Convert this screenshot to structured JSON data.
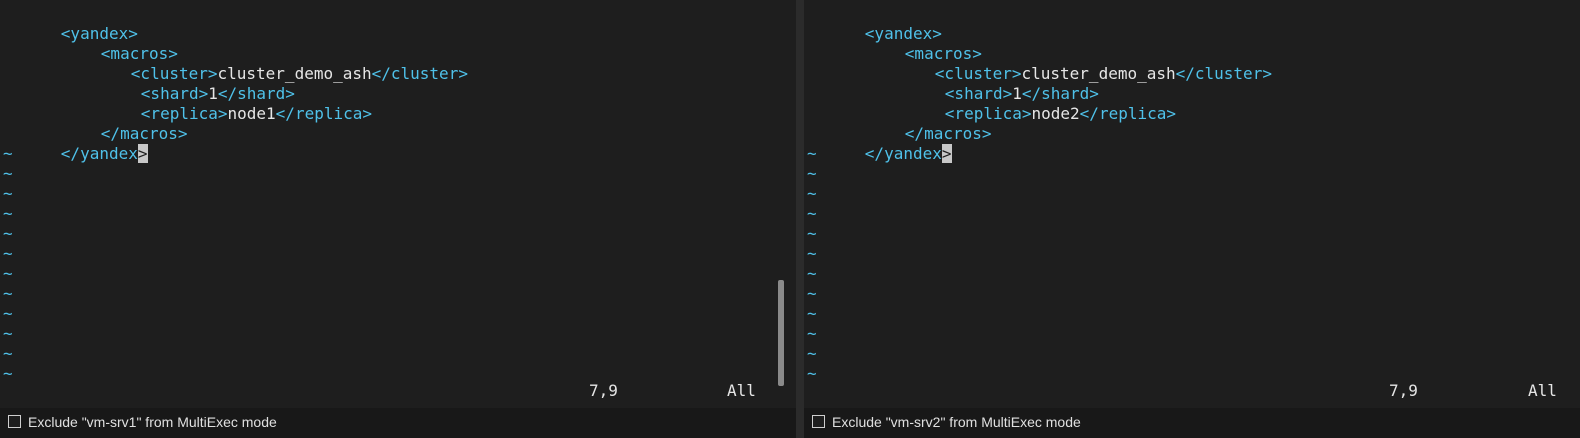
{
  "panes": [
    {
      "id": "left",
      "code": {
        "line1_tag": "<yandex>",
        "line2_tag": "<macros>",
        "line3_open": "<cluster>",
        "line3_text": "cluster_demo_ash",
        "line3_close": "</cluster>",
        "line4_open": "<shard>",
        "line4_text": "1",
        "line4_close": "</shard>",
        "line5_open": "<replica>",
        "line5_text": "node1",
        "line5_close": "</replica>",
        "line6_tag": "</macros>",
        "line7_tag_main": "</yandex",
        "line7_cursor": ">"
      },
      "tilde": "~",
      "status": {
        "position": "7,9",
        "scroll": "All"
      },
      "footer": {
        "label": "Exclude \"vm-srv1\" from MultiExec mode",
        "checked": false
      }
    },
    {
      "id": "right",
      "code": {
        "line1_tag": "<yandex>",
        "line2_tag": "<macros>",
        "line3_open": "<cluster>",
        "line3_text": "cluster_demo_ash",
        "line3_close": "</cluster>",
        "line4_open": "<shard>",
        "line4_text": "1",
        "line4_close": "</shard>",
        "line5_open": "<replica>",
        "line5_text": "node2",
        "line5_close": "</replica>",
        "line6_tag": "</macros>",
        "line7_tag_main": "</yandex",
        "line7_cursor": ">"
      },
      "tilde": "~",
      "status": {
        "position": "7,9",
        "scroll": "All"
      },
      "footer": {
        "label": "Exclude \"vm-srv2\" from MultiExec mode",
        "checked": false
      }
    }
  ],
  "colors": {
    "tag": "#4fc1e9",
    "text": "#e6e6e6",
    "background": "#1e1e1e"
  }
}
